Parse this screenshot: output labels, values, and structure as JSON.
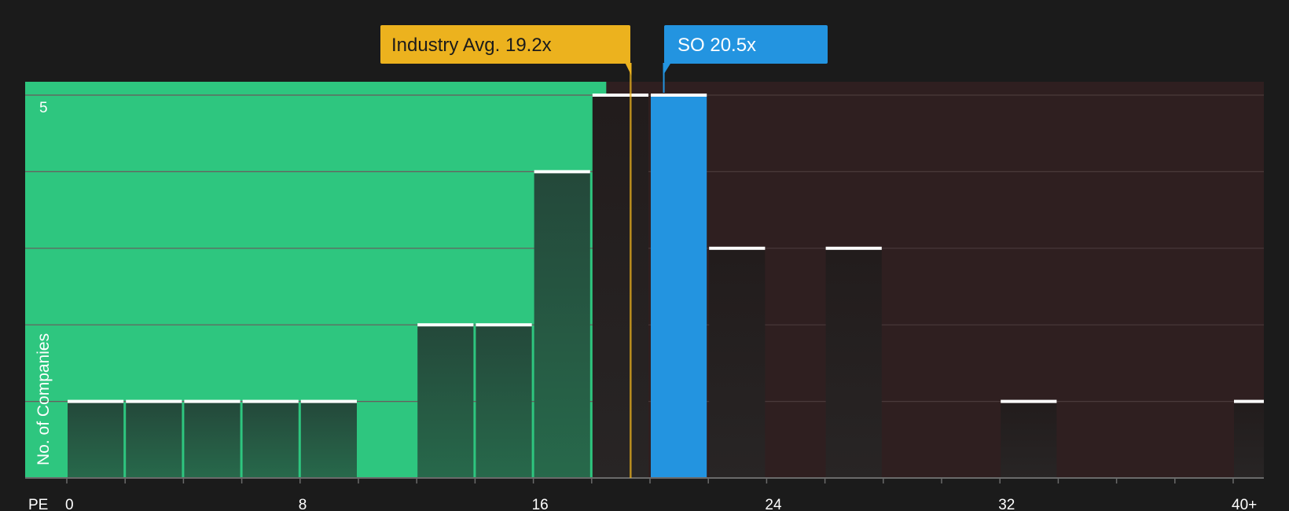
{
  "chart_data": {
    "type": "bar",
    "ylabel": "No. of Companies",
    "xlabel": "PE",
    "ylim": [
      0,
      5
    ],
    "y_ticks": [
      {
        "value": 5,
        "label": "5"
      }
    ],
    "x_ticks": [
      {
        "value": 0,
        "label": "0"
      },
      {
        "value": 8,
        "label": "8"
      },
      {
        "value": 16,
        "label": "16"
      },
      {
        "value": 24,
        "label": "24"
      },
      {
        "value": 32,
        "label": "32"
      },
      {
        "value": 40,
        "label": "40+"
      }
    ],
    "bin_width": 2,
    "bins": [
      {
        "start": 0,
        "count": 1
      },
      {
        "start": 2,
        "count": 1
      },
      {
        "start": 4,
        "count": 1
      },
      {
        "start": 6,
        "count": 1
      },
      {
        "start": 8,
        "count": 1
      },
      {
        "start": 12,
        "count": 2
      },
      {
        "start": 14,
        "count": 2
      },
      {
        "start": 16,
        "count": 4
      },
      {
        "start": 18,
        "count": 5
      },
      {
        "start": 20,
        "count": 5,
        "highlight": true
      },
      {
        "start": 22,
        "count": 3
      },
      {
        "start": 26,
        "count": 3
      },
      {
        "start": 32,
        "count": 1
      },
      {
        "start": 40,
        "count": 1
      }
    ],
    "fair_zone_end": 18.5,
    "industry_avg": {
      "label": "Industry Avg. 19.2x",
      "value": 19.2
    },
    "company": {
      "label": "SO 20.5x",
      "value": 20.5
    },
    "colors": {
      "background": "#1b1b1b",
      "undervalued_zone": "#2ec67f",
      "overvalued_zone": "#2f1f20",
      "industry_avg": "#ecb21e",
      "company": "#2394e0",
      "bar_top": "#ffffff",
      "gridline": "#4a3a3b",
      "axis_text": "#ffffff"
    }
  }
}
